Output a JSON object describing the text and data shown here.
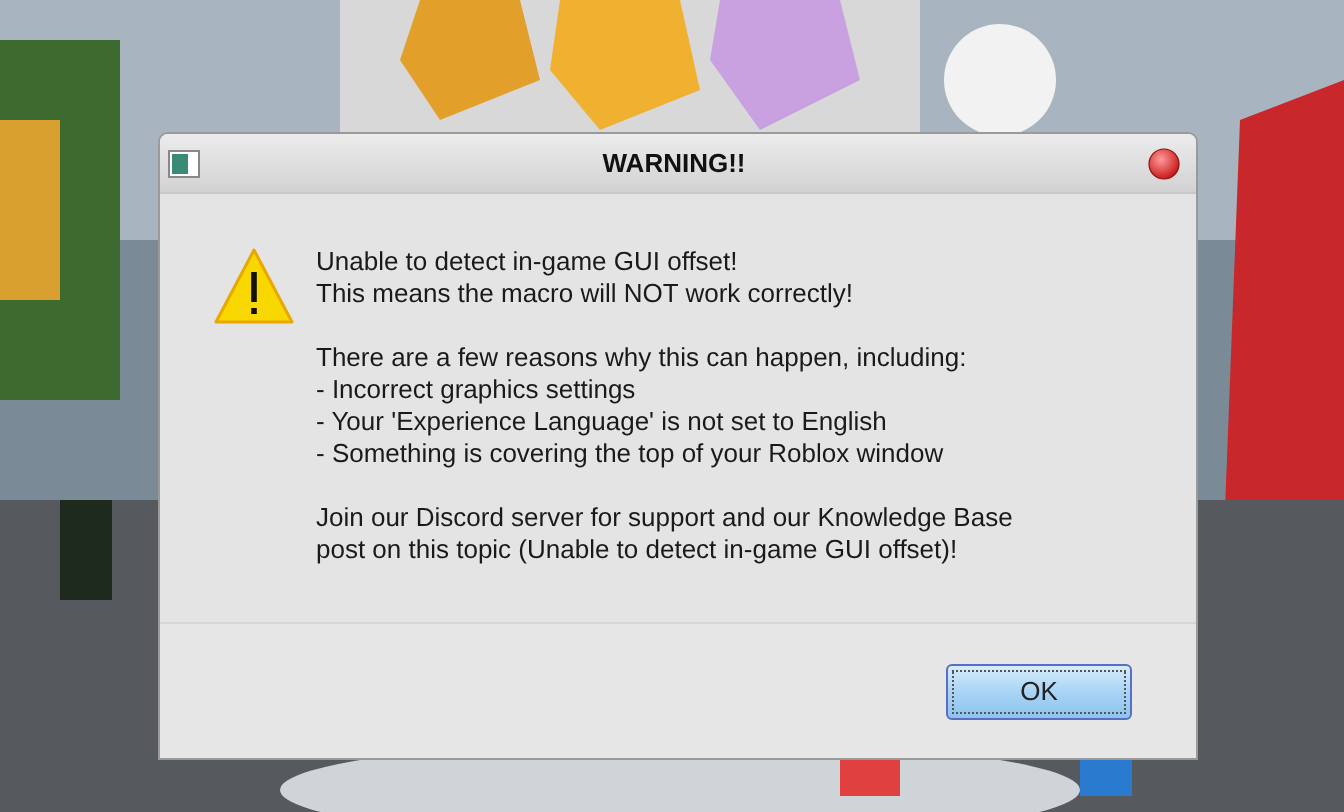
{
  "dialog": {
    "title": "WARNING!!",
    "kind": "warning",
    "message": [
      [
        "Unable to detect in-game GUI offset!",
        "This means the macro will NOT work correctly!"
      ],
      [
        "There are a few reasons why this can happen, including:",
        "- Incorrect graphics settings",
        "- Your 'Experience Language' is not set to English",
        "- Something is covering the top of your Roblox window"
      ],
      [
        "Join our Discord server for support and our Knowledge Base",
        "post on this topic (Unable to detect in-game GUI offset)!"
      ]
    ],
    "buttons": [
      {
        "label": "OK",
        "focused": true
      }
    ]
  }
}
